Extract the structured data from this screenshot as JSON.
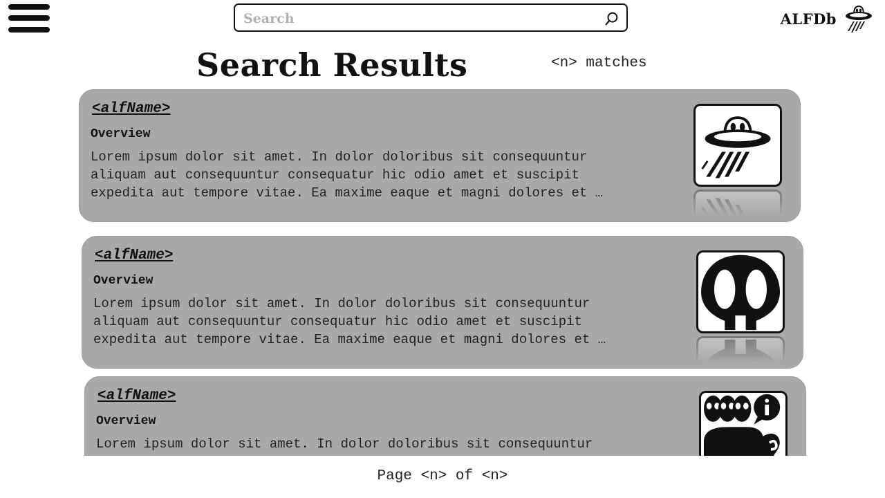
{
  "header": {
    "search": {
      "placeholder": "Search",
      "value": ""
    },
    "brand": {
      "name": "ALFDb",
      "logo_icon": "ufo-logo-icon"
    }
  },
  "main": {
    "title": "Search Results",
    "match_count": "<n> matches",
    "results": [
      {
        "name": "<alfName>",
        "overview_label": "Overview",
        "overview_text": "Lorem ipsum dolor sit amet. In dolor doloribus sit consequuntur\naliquam aut consequuntur consequatur hic odio amet et suscipit\nexpedita aut tempore vitae. Ea maxime eaque et magni dolores et …",
        "thumbnail_icon": "ufo-icon"
      },
      {
        "name": "<alfName>",
        "overview_label": "Overview",
        "overview_text": "Lorem ipsum dolor sit amet. In dolor doloribus sit consequuntur\naliquam aut consequuntur consequatur hic odio amet et suscipit\nexpedita aut tempore vitae. Ea maxime eaque et magni dolores et …",
        "thumbnail_icon": "alien-skull-icon"
      },
      {
        "name": "<alfName>",
        "overview_label": "Overview",
        "overview_text": "Lorem ipsum dolor sit amet. In dolor doloribus sit consequuntur\naliquam aut consequuntur consequatur hic odio amet et suscipit",
        "thumbnail_icon": "alien-info-elephant-icon"
      }
    ]
  },
  "footer": {
    "pagination": "Page <n> of <n>"
  },
  "colors": {
    "card_background": "#a9a9a9",
    "text": "#222222",
    "ink": "#111111",
    "placeholder": "#b0b0b0"
  }
}
